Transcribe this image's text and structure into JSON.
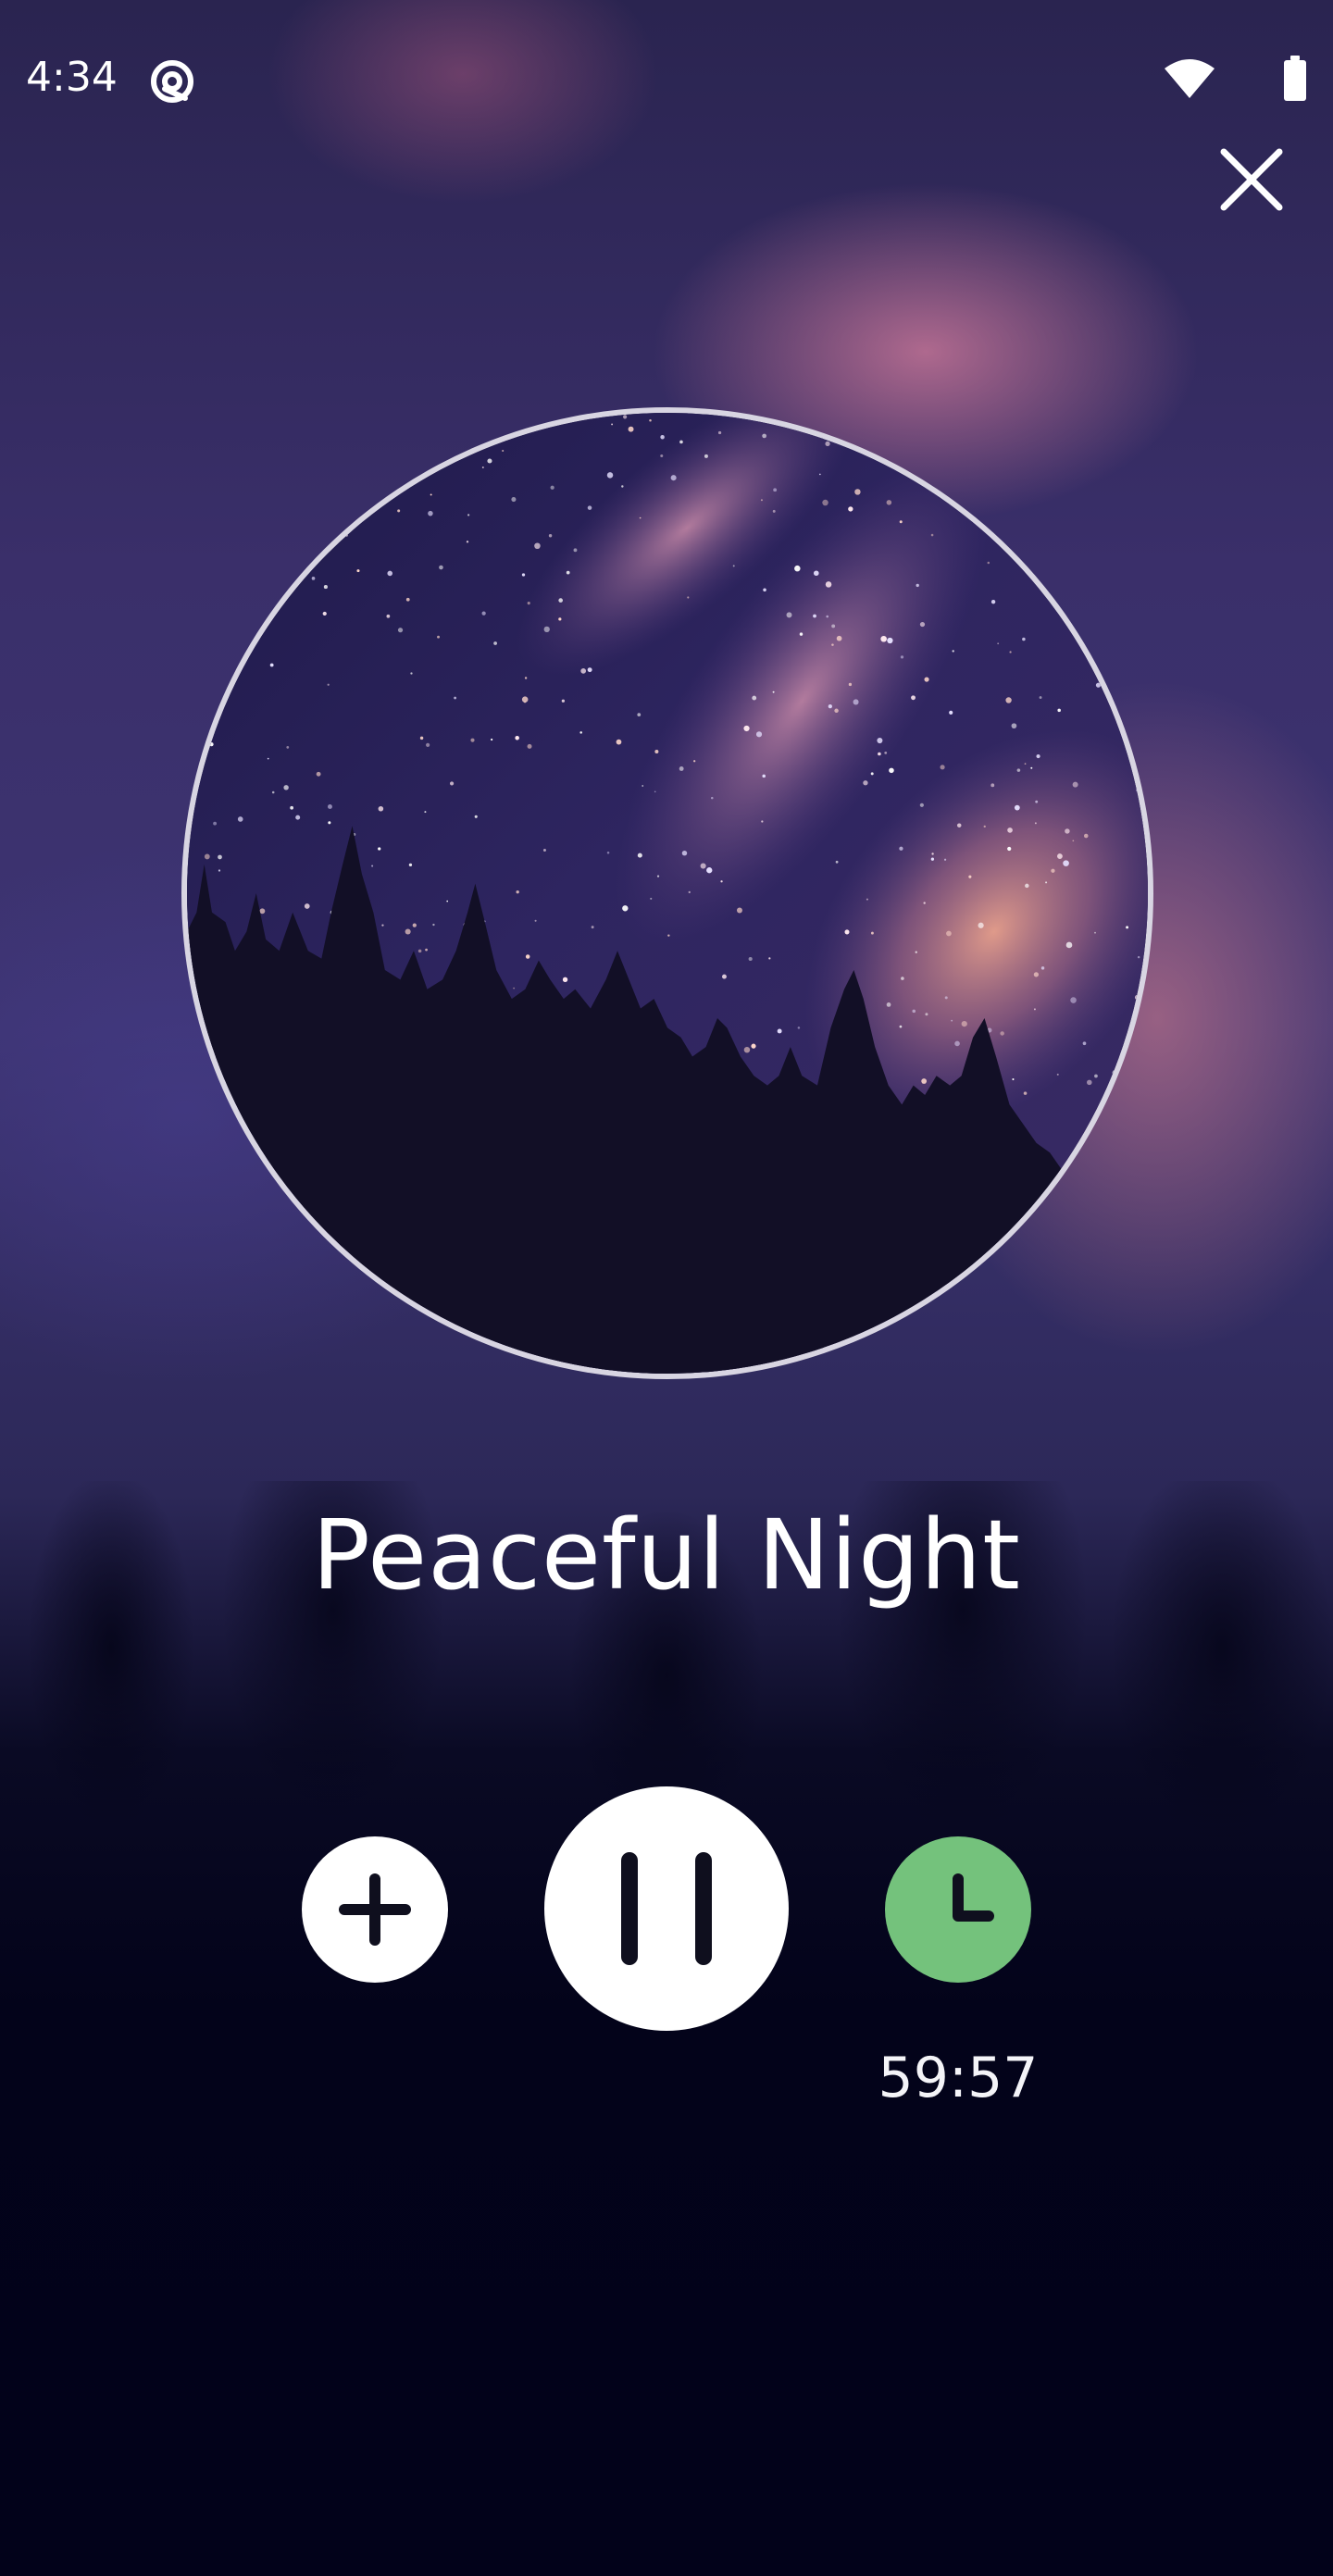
{
  "status_bar": {
    "time": "4:34",
    "icons": [
      "sync-icon",
      "wifi-icon",
      "battery-icon"
    ]
  },
  "header": {
    "close_icon": "close-icon"
  },
  "player": {
    "title": "Peaceful Night",
    "artwork": "night-sky-artwork",
    "controls": {
      "add_icon": "plus-icon",
      "pause_icon": "pause-icon",
      "timer_icon": "clock-icon"
    },
    "timer_remaining": "59:57"
  },
  "colors": {
    "timer_button": "#74c27c",
    "control_button": "#ffffff",
    "icon_dark": "#0f0f1e"
  }
}
